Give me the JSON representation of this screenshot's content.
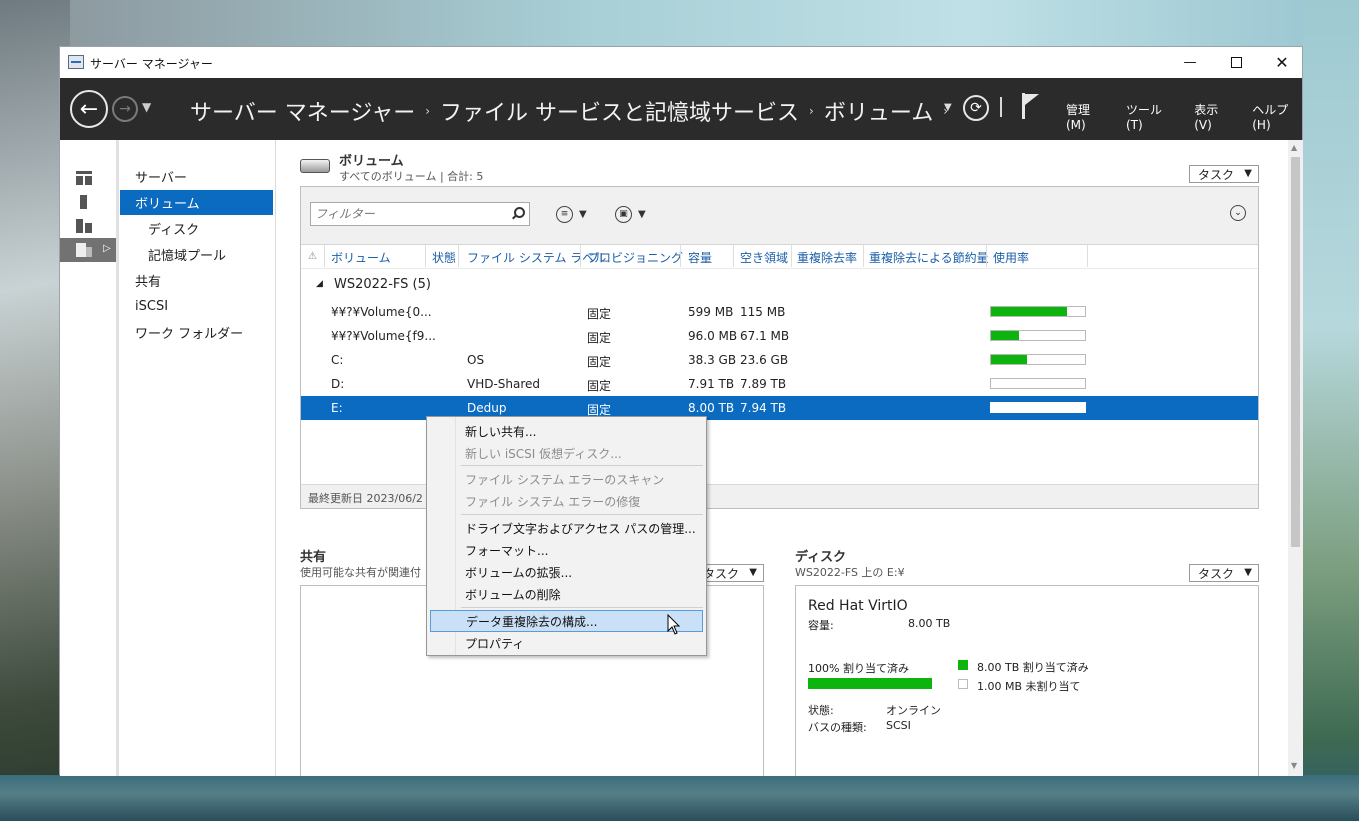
{
  "window": {
    "title": "サーバー マネージャー",
    "min_glyph": "—",
    "close_glyph": "✕"
  },
  "header": {
    "breadcrumb": [
      "サーバー マネージャー",
      "ファイル サービスと記憶域サービス",
      "ボリューム"
    ],
    "sep": "›",
    "menus": [
      "管理(M)",
      "ツール(T)",
      "表示(V)",
      "ヘルプ(H)"
    ]
  },
  "rail": {
    "items": [
      "dashboard-icon",
      "local-server-icon",
      "all-servers-icon",
      "file-services-icon"
    ]
  },
  "nav": {
    "items": [
      {
        "label": "サーバー",
        "sub": false,
        "active": false
      },
      {
        "label": "ボリューム",
        "sub": false,
        "active": true
      },
      {
        "label": "ディスク",
        "sub": true,
        "active": false
      },
      {
        "label": "記憶域プール",
        "sub": true,
        "active": false
      },
      {
        "label": "共有",
        "sub": false,
        "active": false
      },
      {
        "label": "iSCSI",
        "sub": false,
        "active": false
      },
      {
        "label": "ワーク フォルダー",
        "sub": false,
        "active": false
      }
    ]
  },
  "volumes_tile": {
    "title": "ボリューム",
    "subtitle": "すべてのボリューム | 合計: 5",
    "tasks_label": "タスク",
    "filter_placeholder": "フィルター",
    "columns": [
      "⚠",
      "ボリューム",
      "状態",
      "ファイル システム ラベル",
      "プロビジョニング",
      "容量",
      "空き領域",
      "重複除去率",
      "重複除去による節約量",
      "使用率"
    ],
    "group_label": "WS2022-FS (5)",
    "rows": [
      {
        "volume": "¥¥?¥Volume{0...",
        "status": "",
        "label": "",
        "provisioning": "固定",
        "capacity": "599 MB",
        "free": "115 MB",
        "usage": 0.81,
        "selected": false
      },
      {
        "volume": "¥¥?¥Volume{f9...",
        "status": "",
        "label": "",
        "provisioning": "固定",
        "capacity": "96.0 MB",
        "free": "67.1 MB",
        "usage": 0.3,
        "selected": false
      },
      {
        "volume": "C:",
        "status": "",
        "label": "OS",
        "provisioning": "固定",
        "capacity": "38.3 GB",
        "free": "23.6 GB",
        "usage": 0.38,
        "selected": false
      },
      {
        "volume": "D:",
        "status": "",
        "label": "VHD-Shared",
        "provisioning": "固定",
        "capacity": "7.91 TB",
        "free": "7.89 TB",
        "usage": 0.0,
        "selected": false
      },
      {
        "volume": "E:",
        "status": "",
        "label": "Dedup",
        "provisioning": "固定",
        "capacity": "8.00 TB",
        "free": "7.94 TB",
        "usage": 0.01,
        "selected": true
      }
    ],
    "last_updated": "最終更新日 2023/06/2"
  },
  "shares_tile": {
    "title": "共有",
    "subtitle": "使用可能な共有が関連付",
    "tasks_label": "タスク"
  },
  "disk_tile": {
    "title": "ディスク",
    "subtitle": "WS2022-FS 上の E:¥",
    "tasks_label": "タスク",
    "model": "Red Hat VirtIO",
    "capacity_label": "容量:",
    "capacity_value": "8.00 TB",
    "allocated_pct_label": "100% 割り当て済み",
    "legend_allocated": "8.00 TB 割り当て済み",
    "legend_unallocated": "1.00 MB 未割り当て",
    "status_label": "状態:",
    "status_value": "オンライン",
    "bus_label": "バスの種類:",
    "bus_value": "SCSI",
    "allocated_color": "#0db40d"
  },
  "context_menu": {
    "items": [
      {
        "label": "新しい共有...",
        "disabled": false
      },
      {
        "label": "新しい iSCSI 仮想ディスク...",
        "disabled": true
      },
      {
        "label": "ファイル システム エラーのスキャン",
        "disabled": true
      },
      {
        "label": "ファイル システム エラーの修復",
        "disabled": true
      },
      {
        "label": "ドライブ文字およびアクセス パスの管理...",
        "disabled": false
      },
      {
        "label": "フォーマット...",
        "disabled": false
      },
      {
        "label": "ボリュームの拡張...",
        "disabled": false
      },
      {
        "label": "ボリュームの削除",
        "disabled": false
      },
      {
        "label": "データ重複除去の構成...",
        "disabled": false,
        "hover": true
      },
      {
        "label": "プロパティ",
        "disabled": false
      }
    ]
  },
  "colors": {
    "header_bg": "#2b2b2b",
    "selection": "#0b6bc0",
    "usage_fill": "#0db40d",
    "menu_hover": "#c9e0f7"
  }
}
